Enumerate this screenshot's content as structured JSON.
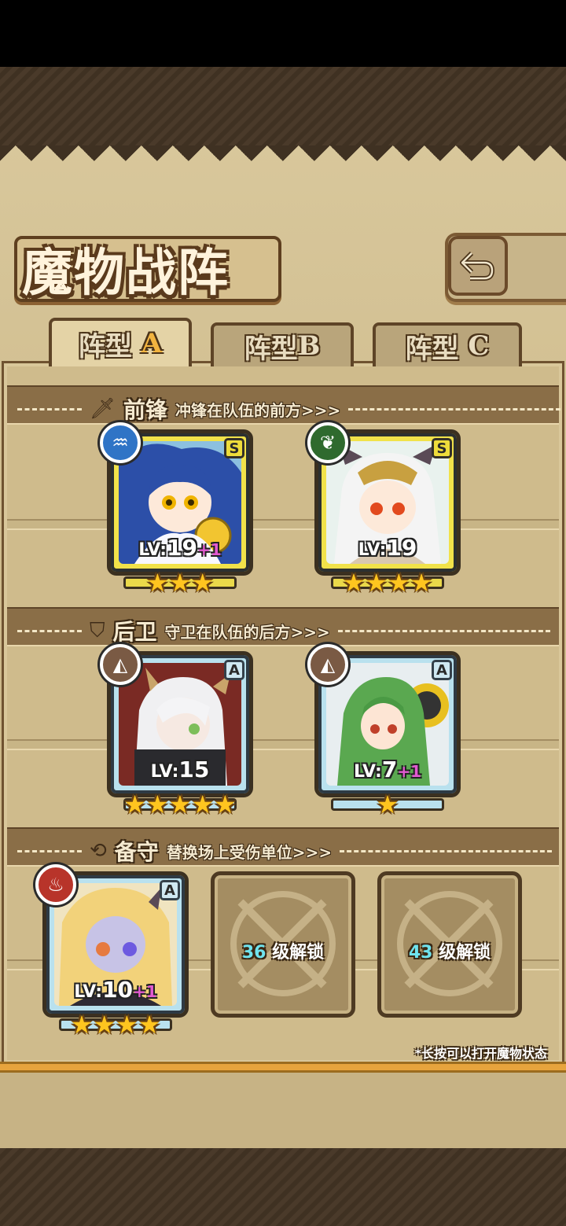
{
  "title": "魔物战阵",
  "tabs": [
    {
      "label": "阵型",
      "letter": "A"
    },
    {
      "label": "阵型",
      "letter": "B"
    },
    {
      "label": "阵型",
      "letter": "C"
    }
  ],
  "sections": {
    "front": {
      "title": "前锋",
      "desc": "冲锋在队伍的前方>>>"
    },
    "back": {
      "title": "后卫",
      "desc": "守卫在队伍的后方>>>"
    },
    "reserve": {
      "title": "备守",
      "desc": "替换场上受伤单位>>>"
    }
  },
  "units": {
    "front1": {
      "lv_prefix": "LV:",
      "level": "19",
      "bonus": "+1",
      "rank": "S",
      "stars": "★★★",
      "element": "water-icon"
    },
    "front2": {
      "lv_prefix": "LV:",
      "level": "19",
      "bonus": "",
      "rank": "S",
      "stars": "★★★★",
      "element": "leaf-icon"
    },
    "back1": {
      "lv_prefix": "LV:",
      "level": "15",
      "bonus": "",
      "rank": "A",
      "stars": "★★★★★",
      "element": "earth-icon"
    },
    "back2": {
      "lv_prefix": "LV:",
      "level": "7",
      "bonus": "+1",
      "rank": "A",
      "stars": "★",
      "element": "earth-icon"
    },
    "reserve1": {
      "lv_prefix": "LV:",
      "level": "10",
      "bonus": "+1",
      "rank": "A",
      "stars": "★★★★",
      "element": "fire-icon"
    }
  },
  "locked_slots": [
    {
      "level": "36",
      "suffix": "级解锁"
    },
    {
      "level": "43",
      "suffix": "级解锁"
    }
  ],
  "hint": "*长按可以打开魔物状态",
  "colors": {
    "accent_gold": "#f2b440",
    "plus_pink": "#e25ad1",
    "unlock_cyan": "#6fe3ee"
  }
}
